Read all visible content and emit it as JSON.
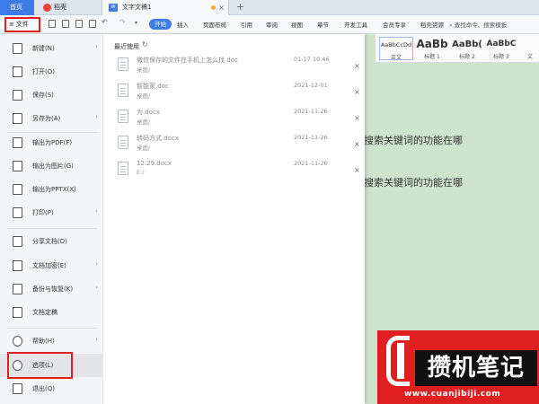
{
  "tabbar": {
    "home": "首页",
    "daoke": "稻壳",
    "doc": "文字文稿1",
    "close": "×",
    "plus": "+"
  },
  "ribbon": {
    "file_button": "文件",
    "tabs": [
      "开始",
      "插入",
      "页面布局",
      "引用",
      "审阅",
      "视图",
      "章节",
      "开发工具",
      "会员专享",
      "稻壳资源"
    ],
    "search": "查找命令、搜索模板"
  },
  "styles": [
    {
      "sample": "AaBbCcDd",
      "name": "正文"
    },
    {
      "sample": "AaBb",
      "name": "标题 1"
    },
    {
      "sample": "AaBb(",
      "name": "标题 2"
    },
    {
      "sample": "AaBbC",
      "name": "标题 3"
    },
    {
      "sample": "",
      "name": "文"
    }
  ],
  "document": {
    "line1": "搜索关键词的功能在哪",
    "line2": "搜索关键词的功能在哪"
  },
  "file_menu": {
    "items": [
      {
        "label": "新建(N)",
        "arrow": "›"
      },
      {
        "label": "打开(O)",
        "arrow": ""
      },
      {
        "label": "保存(S)",
        "arrow": ""
      },
      {
        "label": "另存为(A)",
        "arrow": "›"
      },
      {
        "label": "输出为PDF(F)",
        "arrow": ""
      },
      {
        "label": "输出为图片(G)",
        "arrow": ""
      },
      {
        "label": "输出为PPTX(X)",
        "arrow": ""
      },
      {
        "label": "打印(P)",
        "arrow": "›"
      },
      {
        "label": "分享文档(D)",
        "arrow": ""
      },
      {
        "label": "文档加密(E)",
        "arrow": "›"
      },
      {
        "label": "备份与恢复(K)",
        "arrow": "›"
      },
      {
        "label": "文档定稿",
        "arrow": ""
      },
      {
        "label": "帮助(H)",
        "arrow": "›"
      },
      {
        "label": "选项(L)",
        "arrow": ""
      },
      {
        "label": "退出(Q)",
        "arrow": ""
      }
    ]
  },
  "recent": {
    "title": "最近使用",
    "files": [
      {
        "name": "微信保存的文件在手机上怎么找.doc",
        "path": "桌面/",
        "date": "01-17 10:46"
      },
      {
        "name": "智能家.doc",
        "path": "桌面/",
        "date": "2021-12-01"
      },
      {
        "name": "为.docx",
        "path": "桌面/",
        "date": "2021-11-26"
      },
      {
        "name": "转码方式.docx",
        "path": "桌面/",
        "date": "2021-11-26"
      },
      {
        "name": "12.29.docx",
        "path": "E:/",
        "date": "2021-11-26"
      }
    ]
  },
  "watermark": {
    "title": "攒机笔记",
    "url": "www.cuanjibiji.com"
  },
  "colors": {
    "accent": "#3f7be6",
    "highlight_box": "#e02020",
    "document_bg": "#cde3cc"
  }
}
